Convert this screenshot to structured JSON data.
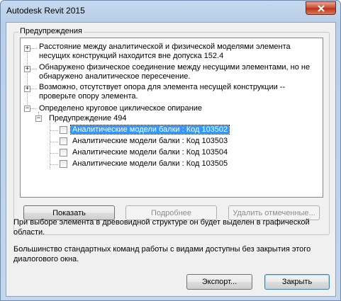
{
  "window": {
    "title": "Autodesk Revit 2015"
  },
  "group": {
    "label": "Предупреждения"
  },
  "tree": {
    "items": [
      {
        "line1": "Расстояние между аналитической и физической моделями элемента",
        "line2": "несущих конструкций находится вне допуска 152.4",
        "expander": "+"
      },
      {
        "line1": "Обнаружено физическое соединение между несущими элементами, но не",
        "line2": "обнаружено аналитическое пересечение.",
        "expander": "+"
      },
      {
        "line1": "Возможно, отсутствует опора для элемента несущей конструкции --",
        "line2": "проверьте опору элемента.",
        "expander": "+"
      },
      {
        "line1": "Определено круговое циклическое опирание",
        "expander": "−"
      }
    ],
    "subgroup": {
      "label": "Предупреждение 494",
      "expander": "−"
    },
    "leaves": [
      "Аналитические модели балки : Код 103502",
      "Аналитические модели балки : Код 103503",
      "Аналитические модели балки : Код 103504",
      "Аналитические модели балки : Код 103505"
    ]
  },
  "buttons": {
    "show": "Показать",
    "details": "Подробнее",
    "delete_checked": "Удалить отмеченные...",
    "export": "Экспорт...",
    "close": "Закрыть"
  },
  "info": {
    "text1_line1": "При выборе элемента в древовидной структуре он будет выделен в графической",
    "text1_line2": "области.",
    "text2_line1": "Большинство стандартных команд работы с видами доступны без закрытия этого",
    "text2_line2": "диалогового окна."
  }
}
